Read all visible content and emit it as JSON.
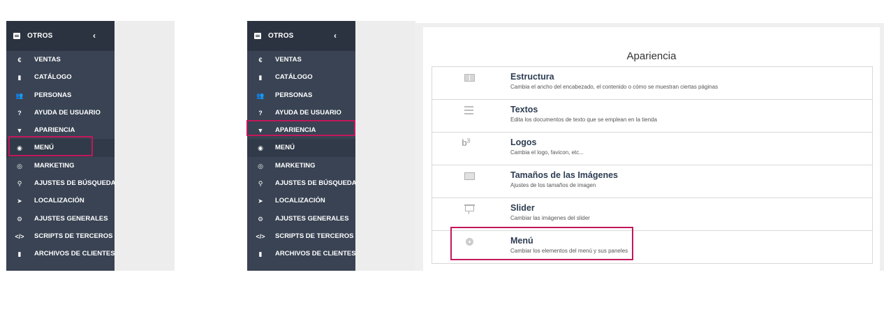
{
  "sidebar": {
    "header_title": "OTROS",
    "collapse_glyph": "‹",
    "items": [
      {
        "label": "VENTAS",
        "icon": "euro-icon",
        "glyph": "€"
      },
      {
        "label": "CATÁLOGO",
        "icon": "book-icon",
        "glyph": "▮"
      },
      {
        "label": "PERSONAS",
        "icon": "users-icon",
        "glyph": "👥"
      },
      {
        "label": "AYUDA DE USUARIO",
        "icon": "question-icon",
        "glyph": "?"
      },
      {
        "label": "APARIENCIA",
        "icon": "paint-icon",
        "glyph": "▼"
      },
      {
        "label": "MENÚ",
        "icon": "compass-icon",
        "glyph": "◉"
      },
      {
        "label": "MARKETING",
        "icon": "target-icon",
        "glyph": "◎"
      },
      {
        "label": "AJUSTES DE BÚSQUEDA",
        "icon": "search-icon",
        "glyph": "⚲"
      },
      {
        "label": "LOCALIZACIÓN",
        "icon": "location-arrow-icon",
        "glyph": "➤"
      },
      {
        "label": "AJUSTES GENERALES",
        "icon": "cogs-icon",
        "glyph": "⚙"
      },
      {
        "label": "SCRIPTS DE TERCEROS",
        "icon": "code-icon",
        "glyph": "</>"
      },
      {
        "label": "ARCHIVOS DE CLIENTES",
        "icon": "file-icon",
        "glyph": "▮"
      }
    ]
  },
  "appearance": {
    "title": "Apariencia",
    "items": [
      {
        "name": "Estructura",
        "description": "Cambia el ancho del encabezado, el contenido o cómo se muestran ciertas páginas",
        "icon": "layout-icon"
      },
      {
        "name": "Textos",
        "description": "Edita los documentos de texto que se emplean en la tienda",
        "icon": "text-lines-icon"
      },
      {
        "name": "Logos",
        "description": "Cambia el logo, favicon, etc...",
        "icon": "blog-logo-icon"
      },
      {
        "name": "Tamaños de las Imágenes",
        "description": "Ajustes de los tamaños de imagen",
        "icon": "image-icon"
      },
      {
        "name": "Slider",
        "description": "Cambiar las imágenes del slider",
        "icon": "presentation-icon"
      },
      {
        "name": "Menú",
        "description": "Cambiar los elementos del menú y sus paneles",
        "icon": "compass-icon"
      }
    ]
  },
  "colors": {
    "sidebar_bg": "#394353",
    "sidebar_header_bg": "#2c3340",
    "highlight": "#c2185b",
    "item_title": "#2d3d52"
  }
}
